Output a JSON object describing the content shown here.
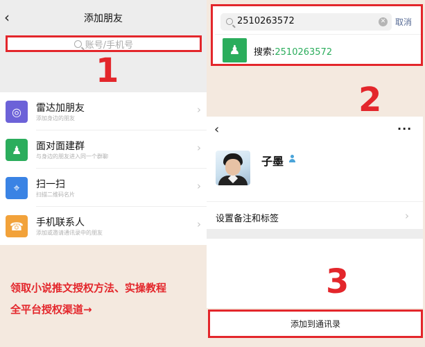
{
  "add_friend_screen": {
    "title": "添加朋友",
    "search_placeholder": "账号/手机号",
    "items": [
      {
        "label": "雷达加朋友",
        "desc": "添加身边的朋友",
        "icon": "radar-icon",
        "color": "#6c62d8"
      },
      {
        "label": "面对面建群",
        "desc": "与身边的朋友进入同一个群聊",
        "icon": "face-to-face-group-icon",
        "color": "#2bad5c"
      },
      {
        "label": "扫一扫",
        "desc": "扫描二维码名片",
        "icon": "scan-icon",
        "color": "#3a83e4"
      },
      {
        "label": "手机联系人",
        "desc": "添加或邀请通讯录中的朋友",
        "icon": "phone-contacts-icon",
        "color": "#f2a23a"
      }
    ]
  },
  "search_screen": {
    "query": "2510263572",
    "cancel_label": "取消",
    "result_prefix": "搜索:",
    "result_value": "2510263572",
    "result_icon": "add-contact-icon"
  },
  "profile_screen": {
    "name": "子墨",
    "remark_label": "设置备注和标签",
    "add_button_label": "添加到通讯录"
  },
  "step_numbers": [
    "1",
    "2",
    "3"
  ],
  "promo": {
    "line1": "领取小说推文授权方法、实操教程",
    "line2": "全平台授权渠道→"
  },
  "colors": {
    "highlight_red": "#e3262b",
    "wechat_green": "#2bad5c",
    "link_blue": "#576b95",
    "background": "#f4e9df"
  }
}
